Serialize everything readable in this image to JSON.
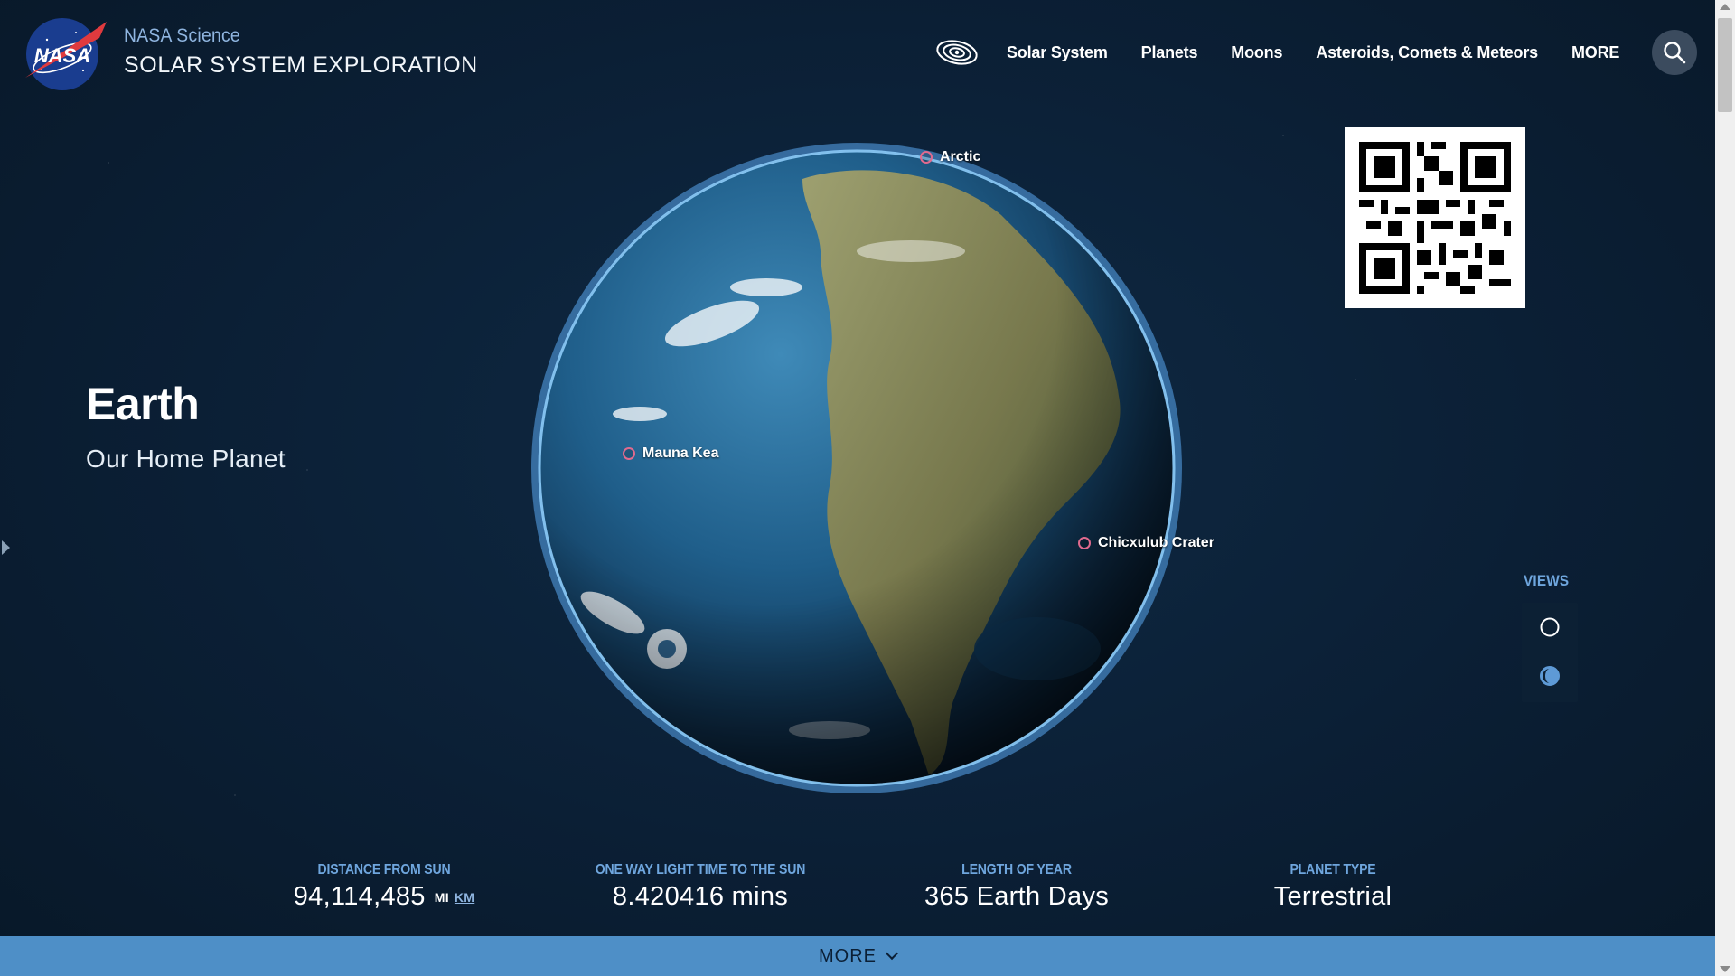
{
  "header": {
    "brand_top": "NASA Science",
    "brand_main": "SOLAR SYSTEM EXPLORATION",
    "logo_text": "NASA"
  },
  "nav": {
    "items": [
      "Solar System",
      "Planets",
      "Moons",
      "Asteroids, Comets & Meteors",
      "MORE"
    ],
    "orbit_icon": "orbit-icon",
    "search_icon": "search-icon"
  },
  "planet": {
    "title": "Earth",
    "subtitle": "Our Home Planet"
  },
  "markers": {
    "arctic": "Arctic",
    "mauna_kea": "Mauna Kea",
    "chicxulub": "Chicxulub Crater"
  },
  "views": {
    "label": "VIEWS",
    "buttons": [
      "circle-view-icon",
      "phase-view-icon"
    ]
  },
  "stats": {
    "distance": {
      "label": "DISTANCE FROM SUN",
      "value": "94,114,485",
      "unit_mi": "MI",
      "unit_km": "KM"
    },
    "light_time": {
      "label": "ONE WAY LIGHT TIME TO THE SUN",
      "value": "8.420416 mins"
    },
    "year": {
      "label": "LENGTH OF YEAR",
      "value": "365 Earth Days"
    },
    "type": {
      "label": "PLANET TYPE",
      "value": "Terrestrial"
    }
  },
  "more_bar": {
    "label": "MORE"
  },
  "colors": {
    "background": "#0b1f35",
    "accent_blue": "#6fa6de",
    "more_bar": "#4e8fc7",
    "marker_ring": "#e06a8e"
  }
}
